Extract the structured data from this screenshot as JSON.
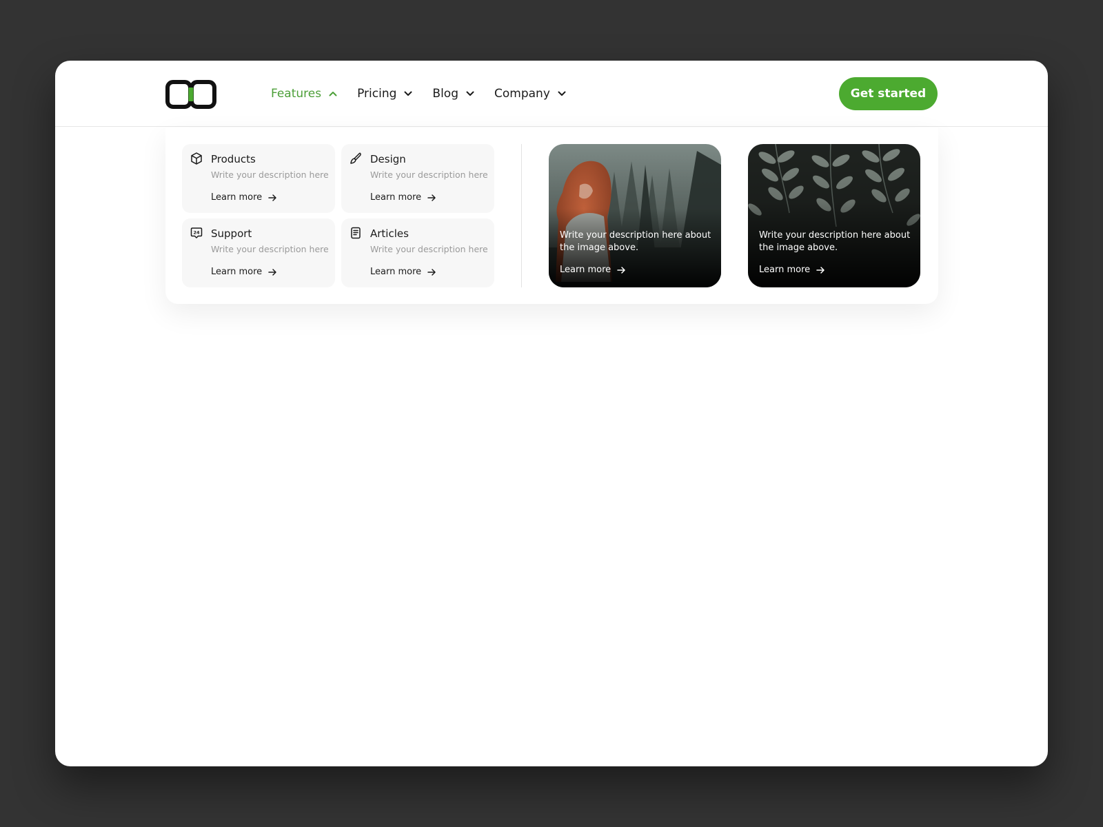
{
  "nav": {
    "logo": "logo-mark",
    "items": [
      {
        "label": "Features",
        "active": true,
        "icon": "chevron-up-icon"
      },
      {
        "label": "Pricing",
        "active": false,
        "icon": "chevron-down-icon"
      },
      {
        "label": "Blog",
        "active": false,
        "icon": "chevron-down-icon"
      },
      {
        "label": "Company",
        "active": false,
        "icon": "chevron-down-icon"
      }
    ],
    "cta_label": "Get started"
  },
  "dropdown": {
    "cards": [
      {
        "title": "Products",
        "icon": "cube-icon",
        "description": "Write your description here",
        "link": "Learn more"
      },
      {
        "title": "Design",
        "icon": "brush-icon",
        "description": "Write your description here",
        "link": "Learn more"
      },
      {
        "title": "Support",
        "icon": "support-24-icon",
        "description": "Write your description here",
        "link": "Learn more"
      },
      {
        "title": "Articles",
        "icon": "document-icon",
        "description": "Write your description here",
        "link": "Learn more"
      }
    ],
    "image_cards": [
      {
        "image": "forest-woman-photo",
        "text": "Write your description here about the image above.",
        "link": "Learn more"
      },
      {
        "image": "leaves-photo",
        "text": "Write your description here about the image above.",
        "link": "Learn more"
      }
    ]
  },
  "colors": {
    "accent": "#4caa30",
    "accent_text": "#4c9f38",
    "page_bg": "#333333",
    "card_bg": "#f7f7f7"
  }
}
